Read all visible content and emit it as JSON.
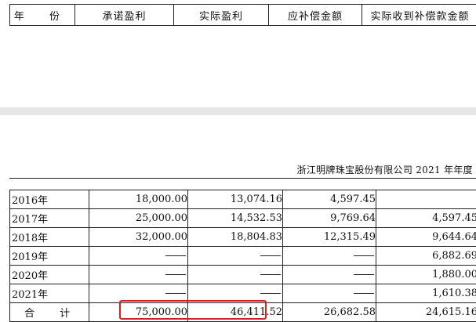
{
  "header": {
    "columns": [
      "年 份",
      "承诺盈利",
      "实际盈利",
      "应补偿金额",
      "实际收到补偿款金额"
    ]
  },
  "report_title": "浙江明牌珠宝股份有限公司 2021 年年度",
  "rows": [
    {
      "year": "2016年",
      "promised": "18,000.00",
      "actual": "13,074.16",
      "comp_due": "4,597.45",
      "comp_received": ""
    },
    {
      "year": "2017年",
      "promised": "25,000.00",
      "actual": "14,532.53",
      "comp_due": "9,769.64",
      "comp_received": "4,597.45"
    },
    {
      "year": "2018年",
      "promised": "32,000.00",
      "actual": "18,804.83",
      "comp_due": "12,315.49",
      "comp_received": "9,644.64"
    },
    {
      "year": "2019年",
      "promised": "——",
      "actual": "——",
      "comp_due": "——",
      "comp_received": "6,882.69"
    },
    {
      "year": "2020年",
      "promised": "——",
      "actual": "——",
      "comp_due": "——",
      "comp_received": "1,880.00"
    },
    {
      "year": "2021年",
      "promised": "——",
      "actual": "——",
      "comp_due": "——",
      "comp_received": "1,610.38"
    }
  ],
  "total": {
    "label": "合 计",
    "promised": "75,000.00",
    "actual": "46,411.52",
    "comp_due": "26,682.58",
    "comp_received": "24,615.16"
  },
  "colors": {
    "highlight_box": "#d81e1e",
    "page_gap": "#e6e6e6"
  }
}
